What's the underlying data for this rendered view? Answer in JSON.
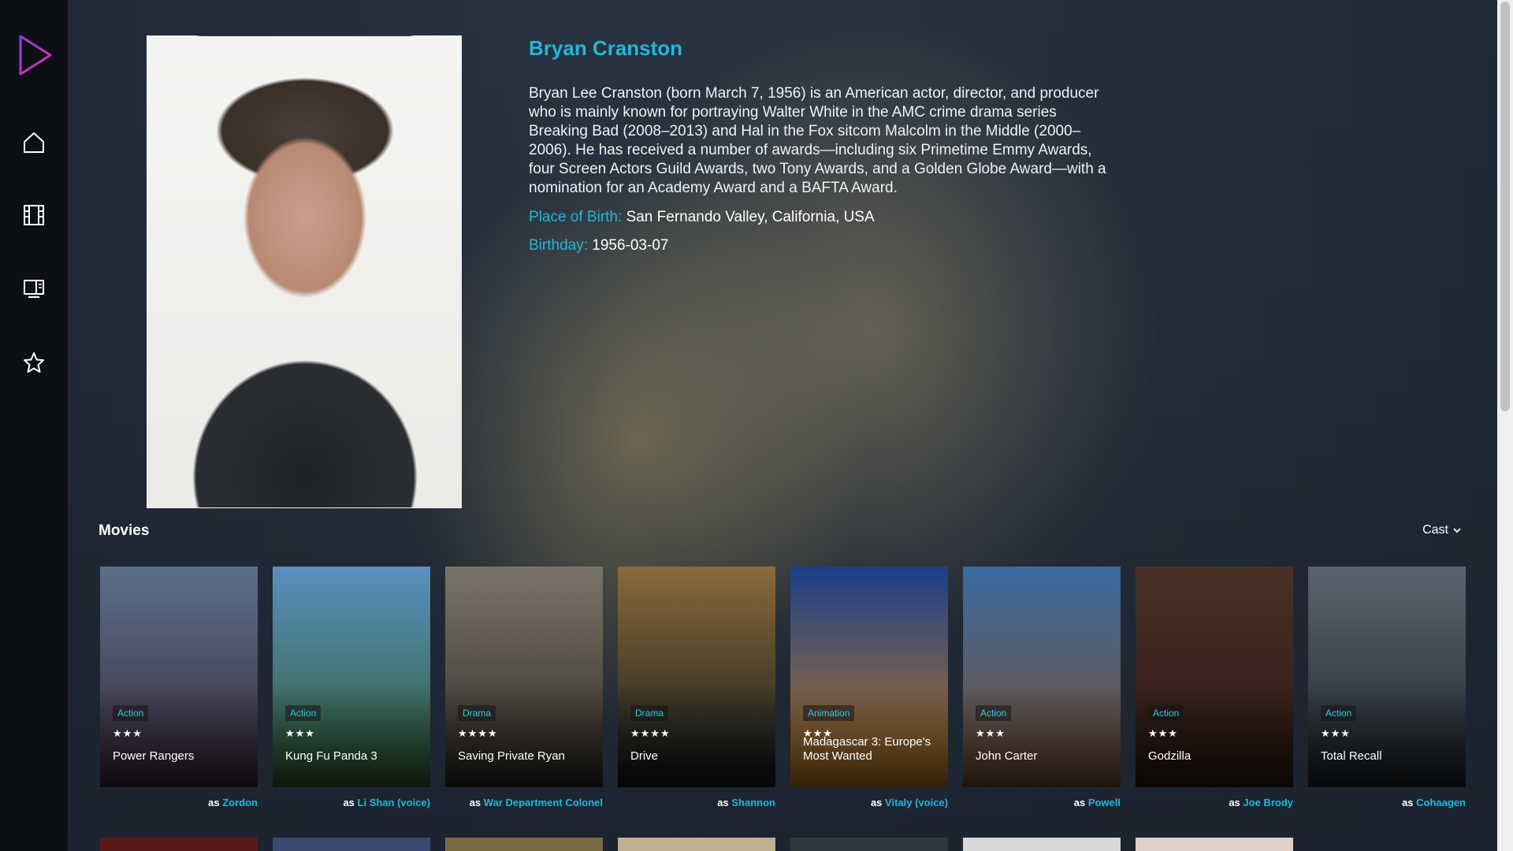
{
  "sidebar": {
    "icons": [
      "play-logo-icon",
      "home-icon",
      "film-icon",
      "tv-icon",
      "star-icon"
    ]
  },
  "person": {
    "name": "Bryan Cranston",
    "bio": "Bryan Lee Cranston (born March 7, 1956) is an American actor, director, and producer who is mainly known for portraying Walter White in the AMC crime drama series Breaking Bad (2008–2013) and Hal in the Fox sitcom Malcolm in the Middle (2000–2006). He has received a number of awards—including six Primetime Emmy Awards, four Screen Actors Guild Awards, two Tony Awards, and a Golden Globe Award—with a nomination for an Academy Award and a BAFTA Award.",
    "place_of_birth_label": "Place of Birth:",
    "place_of_birth": "San Fernando Valley, California, USA",
    "birthday_label": "Birthday:",
    "birthday": "1956-03-07"
  },
  "movies_section": {
    "title": "Movies",
    "filter_label": "Cast",
    "as_prefix": "as"
  },
  "movies": [
    {
      "title": "Power Rangers",
      "genre": "Action",
      "stars": "★★★",
      "character": "Zordon",
      "color_top": "#5b6f8a",
      "color_bottom": "#3a2a3a"
    },
    {
      "title": "Kung Fu Panda 3",
      "genre": "Action",
      "stars": "★★★",
      "character": "Li Shan (voice)",
      "color_top": "#5a8fc0",
      "color_bottom": "#2f5d2e"
    },
    {
      "title": "Saving Private Ryan",
      "genre": "Drama",
      "stars": "★★★★",
      "character": "War Department Colonel",
      "color_top": "#7a7468",
      "color_bottom": "#2e2a24"
    },
    {
      "title": "Drive",
      "genre": "Drama",
      "stars": "★★★★",
      "character": "Shannon",
      "color_top": "#8a6a3a",
      "color_bottom": "#10181c"
    },
    {
      "title": "Madagascar 3: Europe's Most Wanted",
      "genre": "Animation",
      "stars": "★★★",
      "character": "Vitaly (voice)",
      "color_top": "#1a3f8a",
      "color_bottom": "#c07a20"
    },
    {
      "title": "John Carter",
      "genre": "Action",
      "stars": "★★★",
      "character": "Powell",
      "color_top": "#3a6aa0",
      "color_bottom": "#7a5030"
    },
    {
      "title": "Godzilla",
      "genre": "Action",
      "stars": "★★★",
      "character": "Joe Brody",
      "color_top": "#4a3028",
      "color_bottom": "#2a1812"
    },
    {
      "title": "Total Recall",
      "genre": "Action",
      "stars": "★★★",
      "character": "Cohaagen",
      "color_top": "#5a6470",
      "color_bottom": "#1e242a"
    }
  ]
}
